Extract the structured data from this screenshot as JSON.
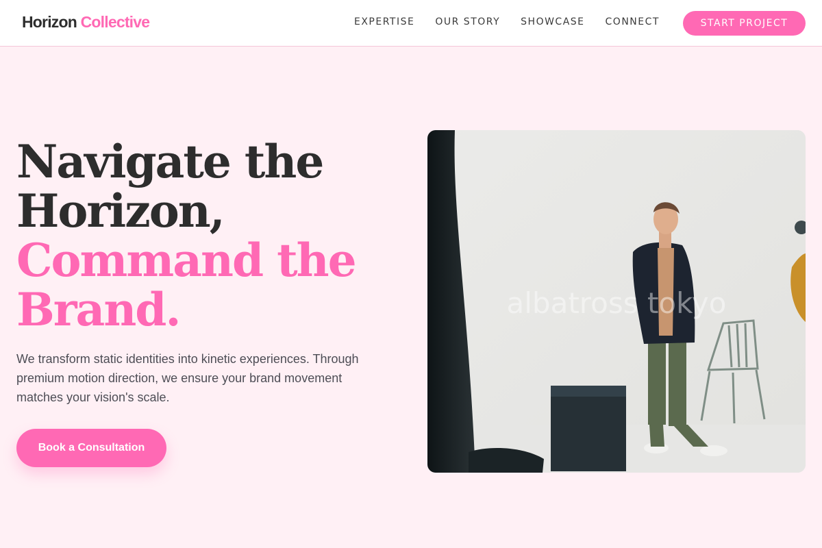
{
  "brand": {
    "part1": "Horizon",
    "part2": "Collective"
  },
  "nav": {
    "links": [
      "EXPERTISE",
      "OUR STORY",
      "SHOWCASE",
      "CONNECT"
    ],
    "cta_label": "START PROJECT"
  },
  "hero": {
    "headline_dark_1": "Navigate the",
    "headline_dark_2": "Horizon,",
    "headline_pink_1": "Command the",
    "headline_pink_2": "Brand.",
    "subtext": "We transform static identities into kinetic experiences. Through premium motion direction, we ensure your brand movement matches your vision's scale.",
    "cta_label": "Book a Consultation",
    "image_watermark": "albatross tokyo"
  },
  "colors": {
    "accent": "#ff69b4",
    "background": "#fff0f5",
    "text": "#2d2d2d"
  }
}
